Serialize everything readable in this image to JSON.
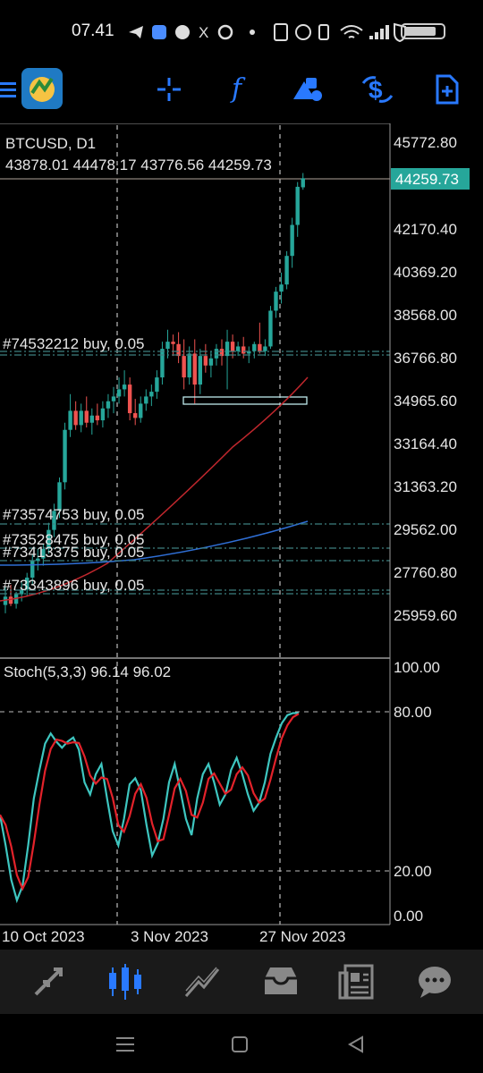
{
  "status_bar": {
    "time": "07.41",
    "icons": [
      "telegram-icon",
      "app-icon",
      "app-icon",
      "x-icon",
      "chrome-icon",
      "dot-icon"
    ],
    "right_icons": [
      "nfc-icon",
      "alarm-icon",
      "vibrate-icon",
      "wifi-icon",
      "signal-icon",
      "shield-icon",
      "battery-icon"
    ]
  },
  "toolbar": {
    "icons": [
      "menu-icon",
      "metatrader-logo",
      "crosshair-icon",
      "indicator-f-icon",
      "objects-icon",
      "currency-icon",
      "new-order-icon"
    ]
  },
  "chart": {
    "symbol": "BTCUSD, D1",
    "ohlc": "43878.01 44478.17 43776.56 44259.73",
    "current_price": "44259.73",
    "price_axis": [
      "45772.80",
      "44259.73",
      "42170.40",
      "40369.20",
      "38568.00",
      "36766.80",
      "34965.60",
      "33164.40",
      "31363.20",
      "29562.00",
      "27760.80",
      "25959.60"
    ],
    "orders": [
      "#74532212 buy, 0.05",
      "#73574753 buy, 0.05",
      "#73528475 buy, 0.05",
      "#73413375 buy, 0.05",
      "#73343896 buy, 0.05"
    ],
    "stoch_label": "Stoch(5,3,3) 96.14 96.02",
    "stoch_axis": [
      "100.00",
      "80.00",
      "20.00",
      "0.00"
    ],
    "date_axis": [
      "10 Oct 2023",
      "3 Nov 2023",
      "27 Nov 2023"
    ],
    "colors": {
      "bull": "#26a69a",
      "bear": "#ef5350",
      "ma_red": "#c0272d",
      "ma_blue": "#2f6fd6",
      "stoch_main": "#3ec6c0",
      "stoch_signal": "#e3222a",
      "accent": "#2979ff"
    }
  },
  "chart_data": {
    "type": "candlestick",
    "title": "BTCUSD, D1",
    "ylim": [
      25059,
      46700
    ],
    "last_close": 44259.73,
    "stoch": {
      "main_last": 96.14,
      "signal_last": 96.02,
      "ylim": [
        0,
        100
      ]
    }
  },
  "tabbar": {
    "tabs": [
      "quotes-icon",
      "chart-icon",
      "trade-icon",
      "history-icon",
      "news-icon",
      "chat-icon"
    ],
    "active": 1
  },
  "navbar": {
    "buttons": [
      "menu-nav-icon",
      "home-nav-icon",
      "back-nav-icon"
    ]
  }
}
